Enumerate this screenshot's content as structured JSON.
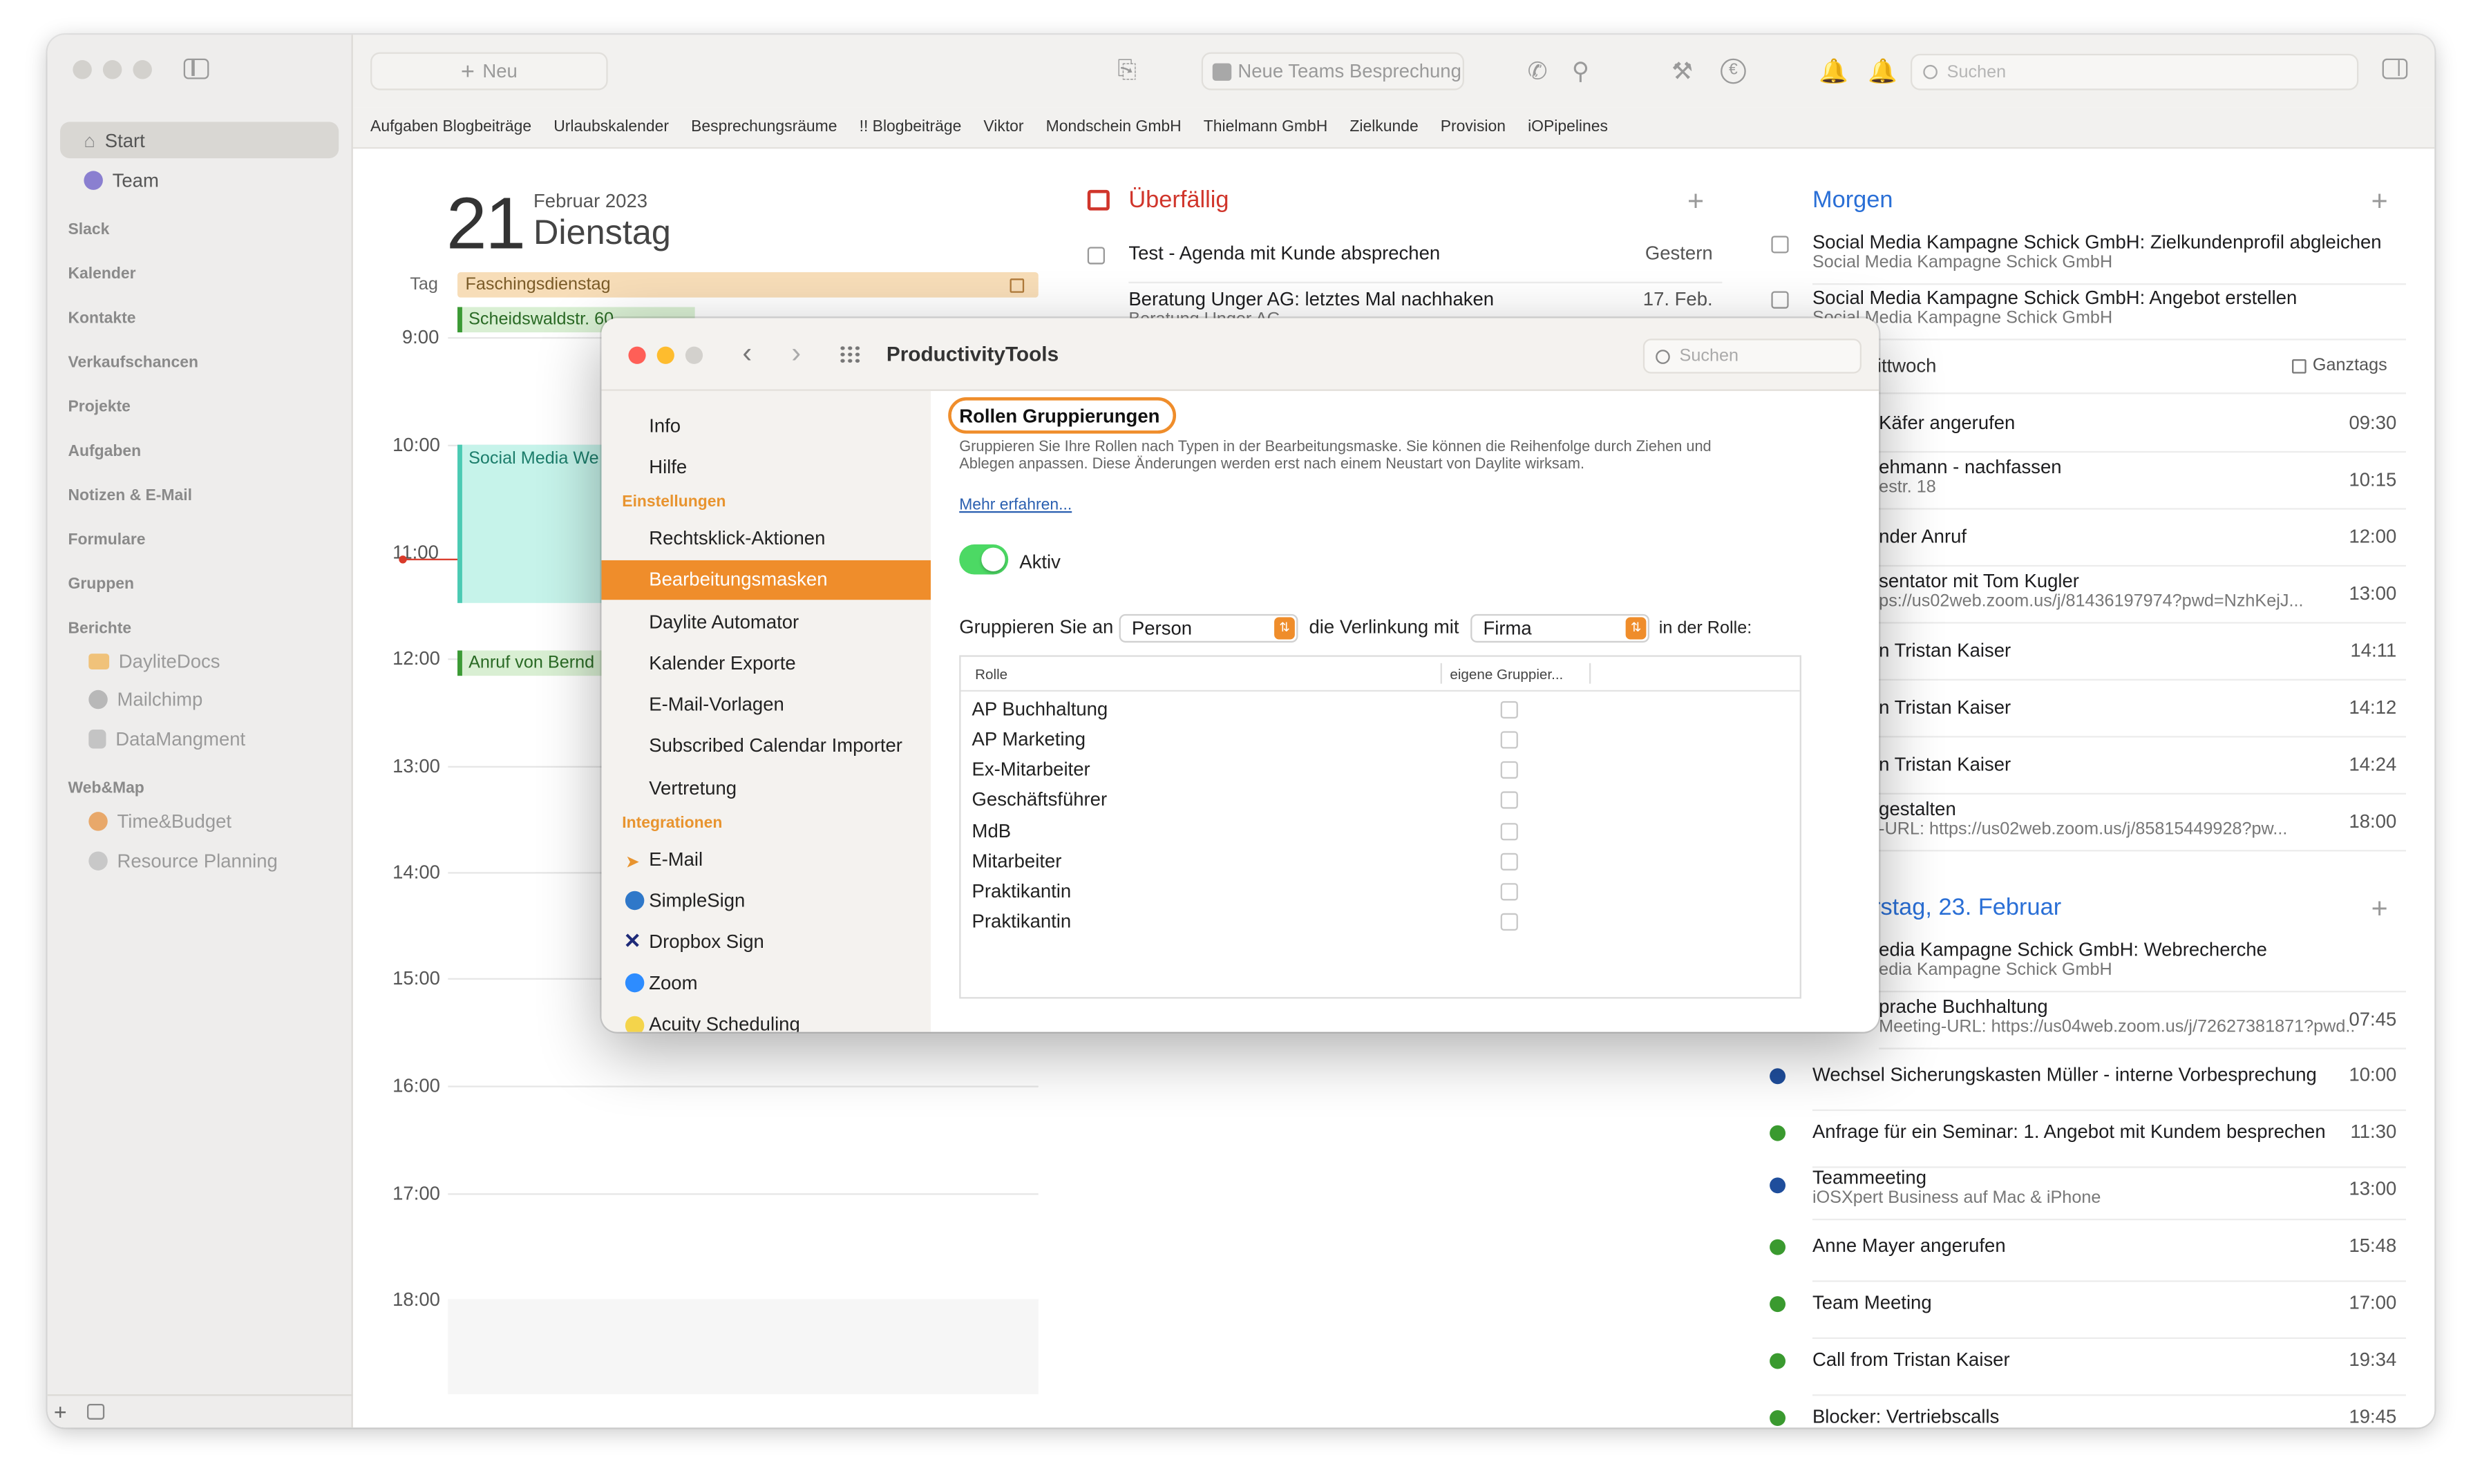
{
  "sidebar": {
    "start": "Start",
    "team": "Team",
    "slack": "Slack",
    "kalender": "Kalender",
    "kontakte": "Kontakte",
    "verkaufschancen": "Verkaufschancen",
    "projekte": "Projekte",
    "aufgaben": "Aufgaben",
    "notizen": "Notizen & E-Mail",
    "formulare": "Formulare",
    "gruppen": "Gruppen",
    "berichte": "Berichte",
    "berichte_items": [
      "DayliteDocs",
      "Mailchimp",
      "DataMangment"
    ],
    "webmap": "Web&Map",
    "webmap_items": [
      "Time&Budget",
      "Resource Planning"
    ]
  },
  "toolbar": {
    "new_label": "Neu",
    "teams_label": "Neue Teams Besprechung",
    "search_placeholder": "Suchen"
  },
  "favorites": [
    "Aufgaben Blogbeiträge",
    "Urlaubskalender",
    "Besprechungsräume",
    "!! Blogbeiträge",
    "Viktor",
    "Mondschein GmbH",
    "Thielmann GmbH",
    "Zielkunde",
    "Provision",
    "iOPipelines"
  ],
  "day": {
    "number": "21",
    "month": "Februar 2023",
    "weekday": "Dienstag",
    "allday_label": "Tag",
    "holiday": "Faschingsdienstag",
    "event_scheidswald": "Scheidswaldstr. 60",
    "event_social": "Social Media We",
    "event_anruf": "Anruf von Bernd",
    "hours": [
      "9:00",
      "10:00",
      "11:00",
      "12:00",
      "13:00",
      "14:00",
      "15:00",
      "16:00",
      "17:00",
      "18:00"
    ]
  },
  "overdue": {
    "title": "Überfällig",
    "items": [
      {
        "text": "Test - Agenda mit Kunde absprechen",
        "date": "Gestern"
      },
      {
        "text": "Beratung Unger AG: letztes Mal nachhaken",
        "date": "17. Feb.",
        "sub": "Beratung Unger AG"
      }
    ]
  },
  "tomorrow": {
    "title": "Morgen",
    "items": [
      {
        "text": "Social Media Kampagne Schick GmbH: Zielkundenprofil abgleichen",
        "sub": "Social Media Kampagne Schick GmbH"
      },
      {
        "text": "Social Media Kampagne Schick GmbH: Angebot erstellen",
        "sub": "Social Media Kampagne Schick GmbH"
      }
    ],
    "mittwoch": "ittwoch",
    "ganztags": "Ganztags",
    "events": [
      {
        "text": "Käfer angerufen",
        "time": "09:30"
      },
      {
        "text": "ehmann - nachfassen",
        "sub": "estr. 18",
        "time": "10:15"
      },
      {
        "text": "nder Anruf",
        "time": "12:00"
      },
      {
        "text": "sentator mit Tom Kugler",
        "sub": "ps://us02web.zoom.us/j/81436197974?pwd=NzhKejJ...",
        "time": "13:00"
      },
      {
        "text": "n Tristan Kaiser",
        "time": "14:11"
      },
      {
        "text": "n Tristan Kaiser",
        "time": "14:12"
      },
      {
        "text": "n Tristan Kaiser",
        "time": "14:24"
      },
      {
        "text": "gestalten",
        "sub": "-URL: https://us02web.zoom.us/j/85815449928?pw...",
        "time": "18:00"
      }
    ]
  },
  "thursday": {
    "title": "rstag, 23. Februar",
    "items": [
      {
        "text": "edia Kampagne Schick GmbH: Webrecherche",
        "sub": "edia Kampagne Schick GmbH"
      },
      {
        "text": "prache Buchhaltung",
        "sub": "Meeting-URL: https://us04web.zoom.us/j/72627381871?pwd...",
        "time": "07:45"
      },
      {
        "text": "Wechsel Sicherungskasten Müller - interne Vorbesprechung",
        "time": "10:00",
        "color": "#1f4e9c"
      },
      {
        "text": "Anfrage für ein Seminar: 1. Angebot mit Kundem besprechen",
        "time": "11:30",
        "color": "#3a9a2f"
      },
      {
        "text": "Teammeeting",
        "sub": "iOSXpert Business auf Mac & iPhone",
        "time": "13:00",
        "color": "#1f4e9c"
      },
      {
        "text": "Anne Mayer angerufen",
        "time": "15:48",
        "color": "#3a9a2f"
      },
      {
        "text": "Team Meeting",
        "time": "17:00",
        "color": "#3a9a2f"
      },
      {
        "text": "Call from Tristan Kaiser",
        "time": "19:34",
        "color": "#3a9a2f"
      },
      {
        "text": "Blocker: Vertriebscalls",
        "time": "19:45",
        "color": "#3a9a2f"
      }
    ]
  },
  "modal": {
    "title": "ProductivityTools",
    "search_placeholder": "Suchen",
    "nav": {
      "info": "Info",
      "hilfe": "Hilfe",
      "einstellungen": "Einstellungen",
      "rechtsklick": "Rechtsklick-Aktionen",
      "bearbeitungsmasken": "Bearbeitungsmasken",
      "automator": "Daylite Automator",
      "kalender_exporte": "Kalender Exporte",
      "email_vorlagen": "E-Mail-Vorlagen",
      "subscribed": "Subscribed Calendar Importer",
      "vertretung": "Vertretung",
      "integrationen": "Integrationen",
      "email": "E-Mail",
      "simplesign": "SimpleSign",
      "dropbox": "Dropbox Sign",
      "zoom": "Zoom",
      "acuity": "Acuity Scheduling"
    },
    "heading": "Rollen Gruppierungen",
    "desc1": "Gruppieren Sie Ihre Rollen nach Typen in der Bearbeitungsmaske. Sie können die Reihenfolge durch Ziehen und",
    "desc2": "Ablegen anpassen. Diese Änderungen werden erst nach einem Neustart von Daylite wirksam.",
    "link": "Mehr erfahren...",
    "toggle_label": "Aktiv",
    "group_label": "Gruppieren Sie an",
    "group_value": "Person",
    "link_label": "die Verlinkung mit",
    "link_value": "Firma",
    "role_label": "in der Rolle:",
    "col_role": "Rolle",
    "col_own": "eigene Gruppier...",
    "roles": [
      "AP Buchhaltung",
      "AP Marketing",
      "Ex-Mitarbeiter",
      "Geschäftsführer",
      "MdB",
      "Mitarbeiter",
      "Praktikantin",
      "Praktikantin"
    ]
  },
  "colors": {
    "accent": "#ef8d2b",
    "overdue_red": "#d0352b",
    "morgen_blue": "#2a6fd6",
    "toggle_green": "#4cd964"
  }
}
